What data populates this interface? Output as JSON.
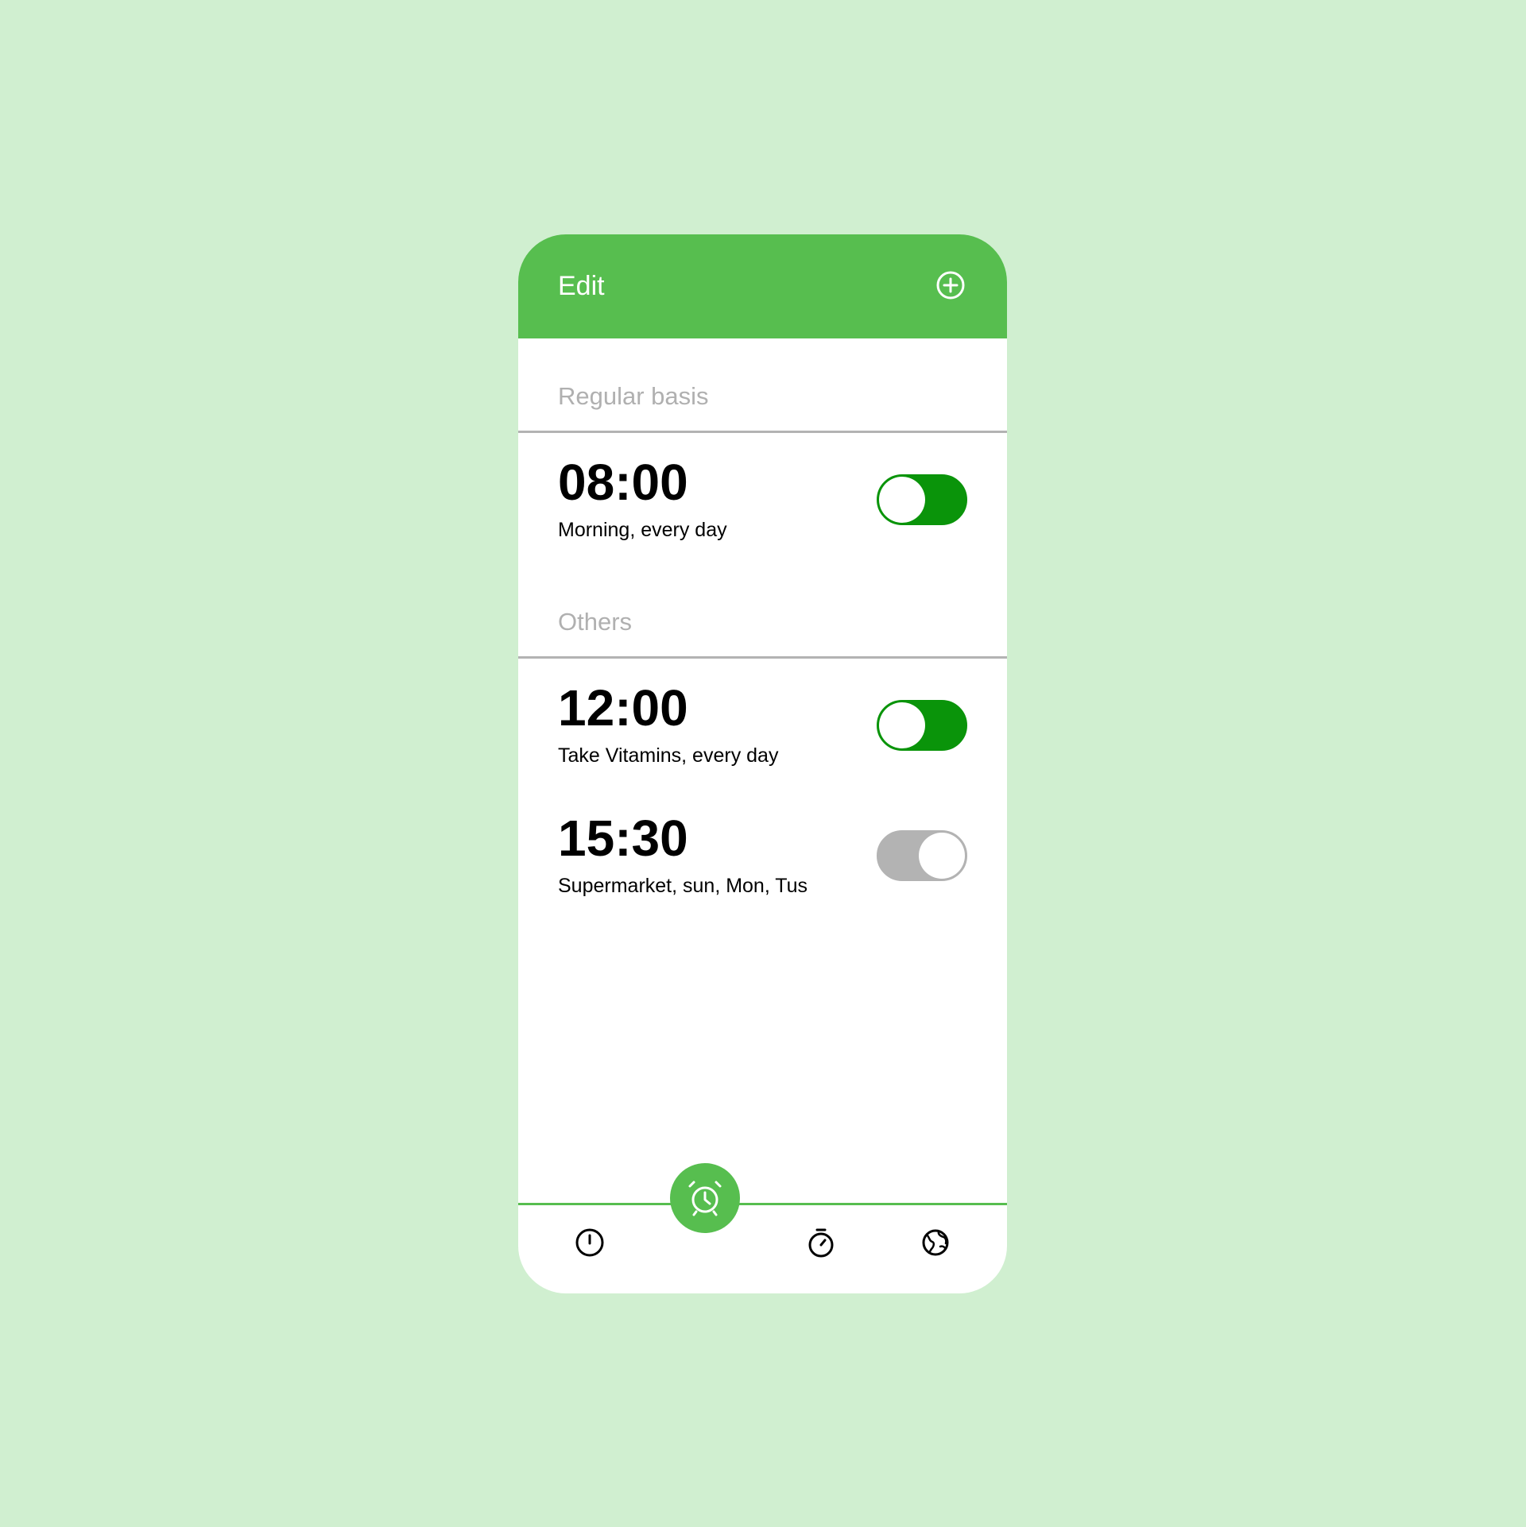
{
  "header": {
    "title": "Edit",
    "add_icon": "plus-circle-icon"
  },
  "sections": [
    {
      "title": "Regular basis",
      "alarms": [
        {
          "time": "08:00",
          "label": "Morning, every day",
          "enabled": true
        }
      ]
    },
    {
      "title": "Others",
      "alarms": [
        {
          "time": "12:00",
          "label": "Take Vitamins, every day",
          "enabled": true
        },
        {
          "time": "15:30",
          "label": "Supermarket, sun, Mon, Tus",
          "enabled": false
        }
      ]
    }
  ],
  "nav": {
    "items": [
      {
        "icon": "clock-icon",
        "active": false
      },
      {
        "icon": "alarm-clock-icon",
        "active": true
      },
      {
        "icon": "stopwatch-icon",
        "active": false
      },
      {
        "icon": "globe-icon",
        "active": false
      }
    ]
  },
  "colors": {
    "background": "#d0efd0",
    "accent": "#57be4f",
    "toggle_on": "#0a940a",
    "toggle_off": "#b3b3b3",
    "section_text": "#b0b0b0"
  }
}
